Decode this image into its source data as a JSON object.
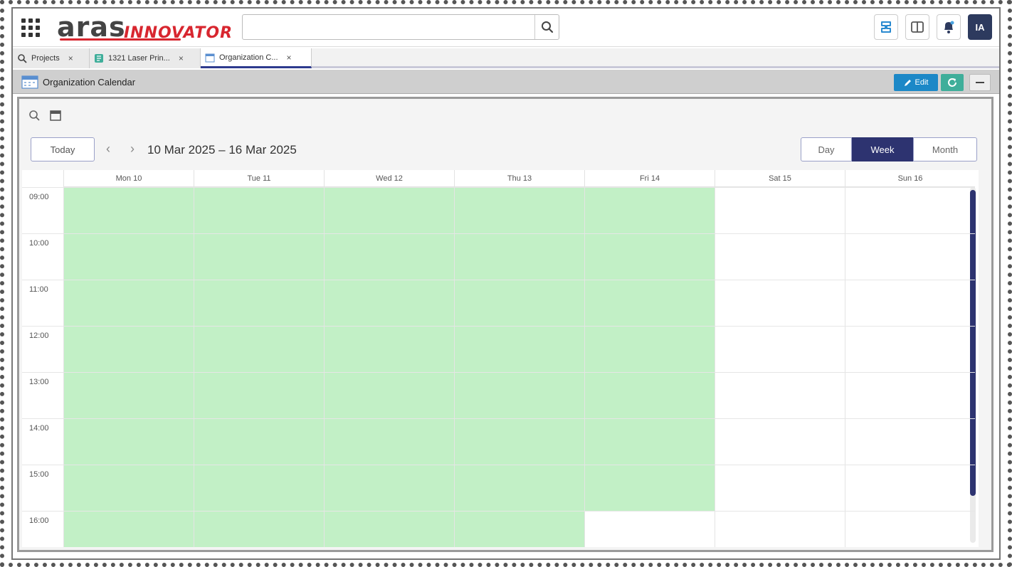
{
  "header": {
    "logo_primary": "aras",
    "logo_secondary": "INNOVATOR",
    "search_placeholder": "",
    "avatar_initials": "IA"
  },
  "tabs": [
    {
      "label": "Projects",
      "close": "×"
    },
    {
      "label": "1321 Laser Prin...",
      "close": "×"
    },
    {
      "label": "Organization C...",
      "close": "×"
    }
  ],
  "titlebar": {
    "title": "Organization Calendar",
    "edit_label": "Edit"
  },
  "calendar": {
    "today_label": "Today",
    "prev_arrow": "‹",
    "next_arrow": "›",
    "date_range": "10 Mar 2025 – 16 Mar 2025",
    "views": [
      "Day",
      "Week",
      "Month"
    ],
    "active_view": "Week",
    "days": [
      "Mon 10",
      "Tue 11",
      "Wed 12",
      "Thu 13",
      "Fri 14",
      "Sat 15",
      "Sun 16"
    ],
    "hours": [
      "09:00",
      "10:00",
      "11:00",
      "12:00",
      "13:00",
      "14:00",
      "15:00",
      "16:00"
    ],
    "working_color": "#c2f0c6"
  },
  "colors": {
    "accent": "#2d3370",
    "edit": "#1c88c7",
    "refresh": "#3fae9a",
    "brand_red": "#d8262f"
  }
}
